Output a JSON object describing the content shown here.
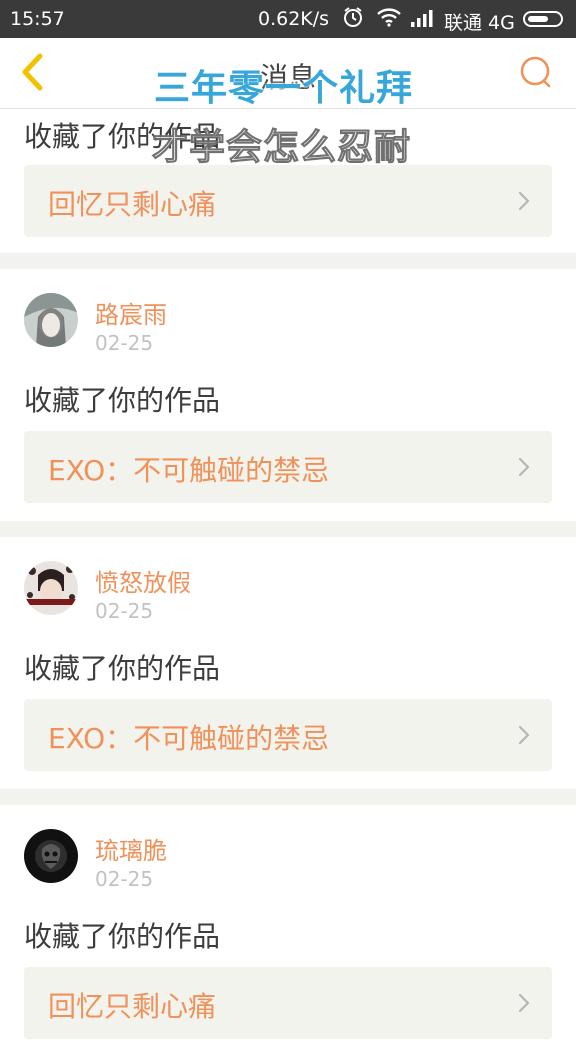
{
  "status_bar": {
    "time": "15:57",
    "net_speed": "0.62K/s",
    "carrier": "联通 4G",
    "icons": [
      "alarm-icon",
      "wifi-icon",
      "signal-icon",
      "battery-icon"
    ]
  },
  "header": {
    "title": "消息",
    "back_icon": "chevron-left-icon",
    "search_icon": "search-icon"
  },
  "overlay_lyrics": {
    "line1": "三年零一个礼拜",
    "line2": "才学会怎么忍耐"
  },
  "colors": {
    "accent": "#f0915a",
    "lyric_blue": "#37a7d9",
    "back_arrow": "#f2c200",
    "card_bg": "#f3f3ed",
    "page_bg": "#f2f2ef"
  },
  "notifications": [
    {
      "action": "收藏了你的作品",
      "work_title": "回忆只剩心痛"
    },
    {
      "user": "路宸雨",
      "date": "02-25",
      "action": "收藏了你的作品",
      "work_title": "EXO：不可触碰的禁忌"
    },
    {
      "user": "愤怒放假",
      "date": "02-25",
      "action": "收藏了你的作品",
      "work_title": "EXO：不可触碰的禁忌"
    },
    {
      "user": "琉璃脆",
      "date": "02-25",
      "action": "收藏了你的作品",
      "work_title": "回忆只剩心痛"
    }
  ]
}
